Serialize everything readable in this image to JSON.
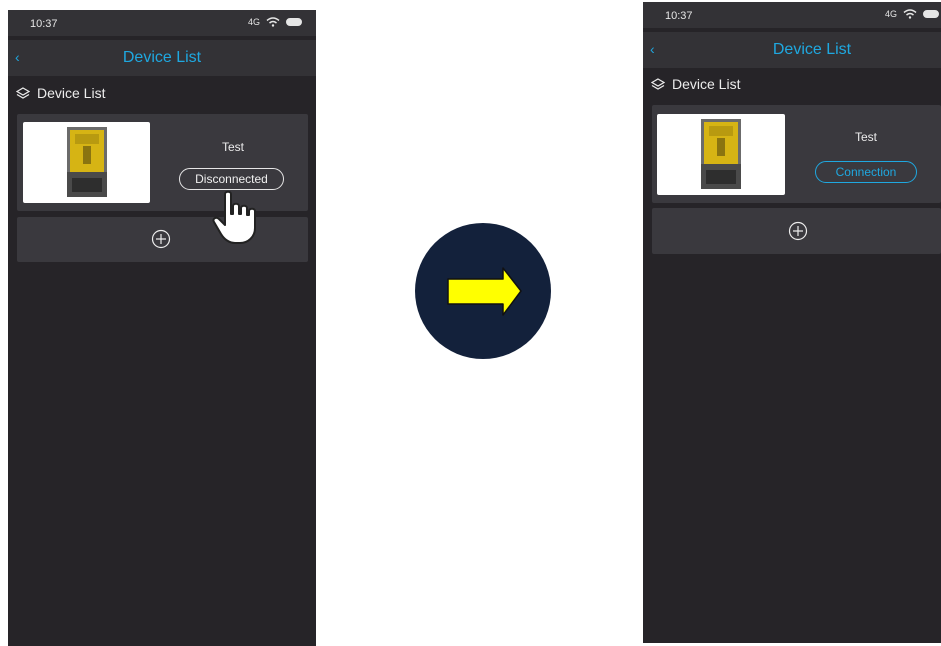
{
  "before_screen": {
    "status": {
      "time": "10:37",
      "signal": "4G"
    },
    "nav": {
      "back": "‹",
      "title": "Device List"
    },
    "section": {
      "icon": "layers-icon",
      "label": "Device List"
    },
    "device": {
      "name": "Test",
      "status_label": "Disconnected"
    },
    "add_button": {
      "icon": "add-circle-icon"
    }
  },
  "after_screen": {
    "status": {
      "time": "10:37",
      "signal": "4G"
    },
    "nav": {
      "back": "‹",
      "title": "Device List"
    },
    "section": {
      "icon": "layers-icon",
      "label": "Device List"
    },
    "device": {
      "name": "Test",
      "status_label": "Connection"
    },
    "add_button": {
      "icon": "add-circle-icon"
    }
  },
  "transition_arrow": {
    "icon": "right-arrow-icon",
    "fill": "#ffff00",
    "disc": "#13213b"
  },
  "colors": {
    "accent": "#1fa8e0",
    "background": "#262428",
    "bar": "#333236",
    "card": "#3a393e"
  }
}
